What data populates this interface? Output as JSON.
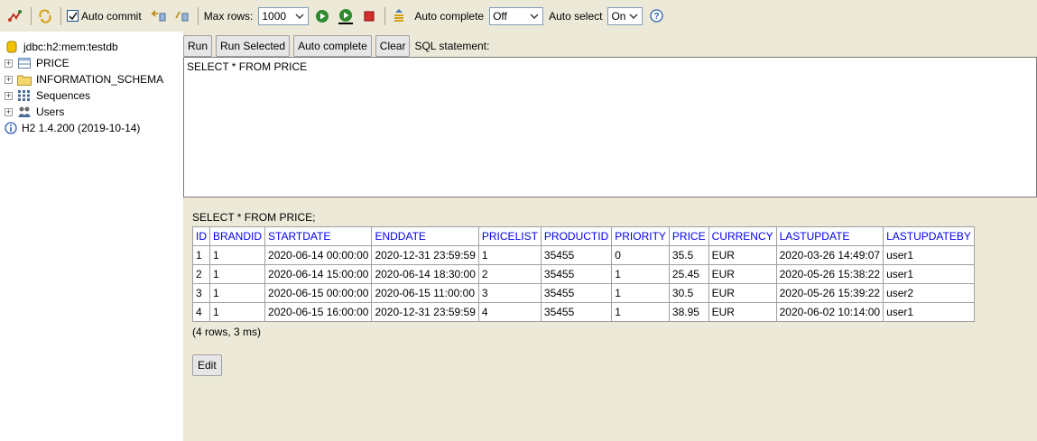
{
  "toolbar": {
    "auto_commit_label": "Auto commit",
    "auto_commit_checked": true,
    "max_rows_label": "Max rows:",
    "max_rows_value": "1000",
    "auto_complete_label": "Auto complete",
    "auto_complete_value": "Off",
    "auto_select_label": "Auto select",
    "auto_select_value": "On",
    "help_glyph": "?"
  },
  "tree": {
    "connection": "jdbc:h2:mem:testdb",
    "items": [
      {
        "label": "PRICE",
        "icon": "table-icon"
      },
      {
        "label": "INFORMATION_SCHEMA",
        "icon": "folder-icon"
      },
      {
        "label": "Sequences",
        "icon": "sequences-icon"
      },
      {
        "label": "Users",
        "icon": "users-icon"
      }
    ],
    "version": "H2 1.4.200 (2019-10-14)"
  },
  "buttons": {
    "run": "Run",
    "run_selected": "Run Selected",
    "auto_complete": "Auto complete",
    "clear": "Clear",
    "sql_statement_label": "SQL statement:"
  },
  "editor": {
    "text": "SELECT * FROM PRICE"
  },
  "result": {
    "query": "SELECT * FROM PRICE;",
    "columns": [
      "ID",
      "BRANDID",
      "STARTDATE",
      "ENDDATE",
      "PRICELIST",
      "PRODUCTID",
      "PRIORITY",
      "PRICE",
      "CURRENCY",
      "LASTUPDATE",
      "LASTUPDATEBY"
    ],
    "rows": [
      [
        "1",
        "1",
        "2020-06-14 00:00:00",
        "2020-12-31 23:59:59",
        "1",
        "35455",
        "0",
        "35.5",
        "EUR",
        "2020-03-26 14:49:07",
        "user1"
      ],
      [
        "2",
        "1",
        "2020-06-14 15:00:00",
        "2020-06-14 18:30:00",
        "2",
        "35455",
        "1",
        "25.45",
        "EUR",
        "2020-05-26 15:38:22",
        "user1"
      ],
      [
        "3",
        "1",
        "2020-06-15 00:00:00",
        "2020-06-15 11:00:00",
        "3",
        "35455",
        "1",
        "30.5",
        "EUR",
        "2020-05-26 15:39:22",
        "user2"
      ],
      [
        "4",
        "1",
        "2020-06-15 16:00:00",
        "2020-12-31 23:59:59",
        "4",
        "35455",
        "1",
        "38.95",
        "EUR",
        "2020-06-02 10:14:00",
        "user1"
      ]
    ],
    "row_count": "(4 rows, 3 ms)",
    "edit_label": "Edit"
  },
  "colors": {
    "panel": "#ece9d8",
    "header_link": "#0000ee"
  }
}
